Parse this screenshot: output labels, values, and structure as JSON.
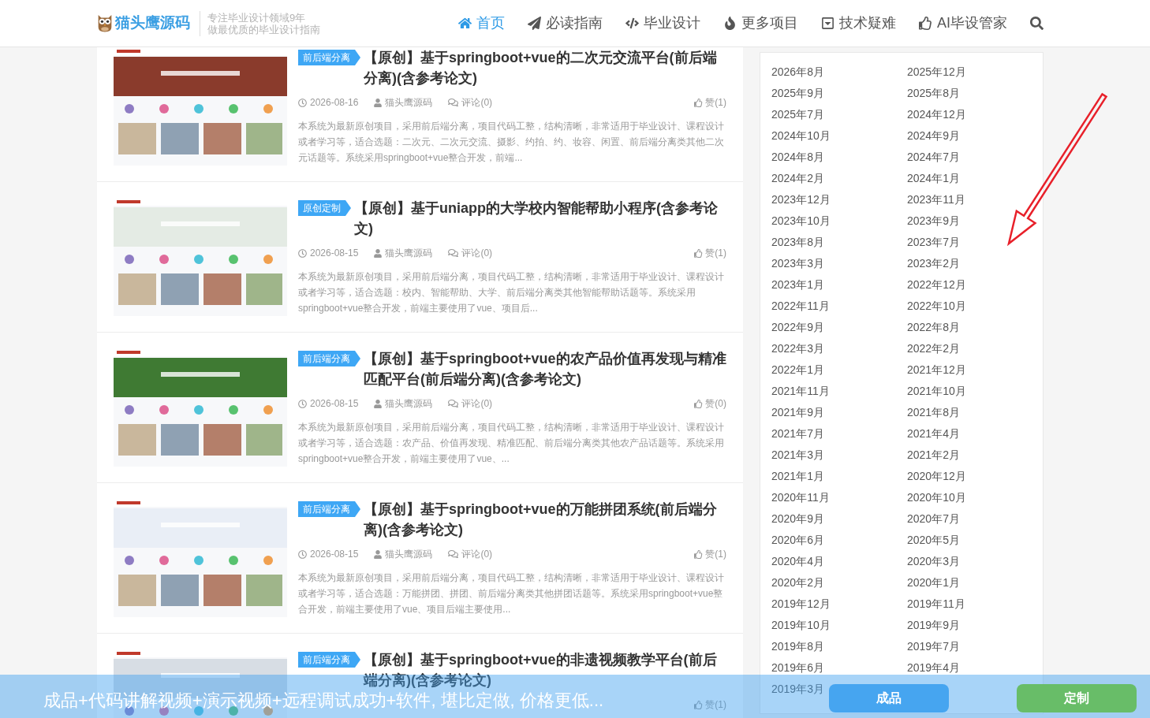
{
  "header": {
    "site_name": "猫头鹰源码",
    "tagline": [
      "专注毕业设计领域9年",
      "做最优质的毕业设计指南"
    ],
    "nav": [
      {
        "label": "首页",
        "selected": true
      },
      {
        "label": "必读指南",
        "selected": false
      },
      {
        "label": "毕业设计",
        "selected": false
      },
      {
        "label": "更多项目",
        "selected": false
      },
      {
        "label": "技术疑难",
        "selected": false
      },
      {
        "label": "AI毕设管家",
        "selected": false
      }
    ]
  },
  "articles": [
    {
      "tag": "前后端分离",
      "title": "【原创】基于springboot+vue的二次元交流平台(前后端分离)(含参考论文)",
      "date": "2026-08-16",
      "author": "猫头鹰源码",
      "comments": "评论(0)",
      "likes": "赞(1)",
      "excerpt": "本系统为最新原创项目，采用前后端分离，项目代码工整，结构清晰，非常适用于毕业设计、课程设计或者学习等，适合选题：二次元、二次元交流、摄影、约拍、约、妆容、闲置、前后端分离类其他二次元话题等。系统采用springboot+vue整合开发，前端..."
    },
    {
      "tag": "原创定制",
      "title": "【原创】基于uniapp的大学校内智能帮助小程序(含参考论文)",
      "date": "2026-08-15",
      "author": "猫头鹰源码",
      "comments": "评论(0)",
      "likes": "赞(1)",
      "excerpt": "本系统为最新原创项目，采用前后端分离，项目代码工整，结构清晰，非常适用于毕业设计、课程设计或者学习等，适合选题：校内、智能帮助、大学、前后端分离类其他智能帮助话题等。系统采用springboot+vue整合开发，前端主要使用了vue、项目后..."
    },
    {
      "tag": "前后端分离",
      "title": "【原创】基于springboot+vue的农产品价值再发现与精准匹配平台(前后端分离)(含参考论文)",
      "date": "2026-08-15",
      "author": "猫头鹰源码",
      "comments": "评论(0)",
      "likes": "赞(0)",
      "excerpt": "本系统为最新原创项目，采用前后端分离，项目代码工整，结构清晰，非常适用于毕业设计、课程设计或者学习等，适合选题：农产品、价值再发现、精准匹配、前后端分离类其他农产品话题等。系统采用springboot+vue整合开发，前端主要使用了vue、..."
    },
    {
      "tag": "前后端分离",
      "title": "【原创】基于springboot+vue的万能拼团系统(前后端分离)(含参考论文)",
      "date": "2026-08-15",
      "author": "猫头鹰源码",
      "comments": "评论(0)",
      "likes": "赞(1)",
      "excerpt": "本系统为最新原创项目，采用前后端分离，项目代码工整，结构清晰，非常适用于毕业设计、课程设计或者学习等，适合选题：万能拼团、拼团、前后端分离类其他拼团话题等。系统采用springboot+vue整合开发，前端主要使用了vue、项目后端主要使用..."
    },
    {
      "tag": "前后端分离",
      "title": "【原创】基于springboot+vue的非遗视频教学平台(前后端分离)(含参考论文)",
      "likes": "赞(1)"
    }
  ],
  "archive": {
    "months": [
      "2026年8月",
      "2025年12月",
      "2025年9月",
      "2025年8月",
      "2025年7月",
      "2024年12月",
      "2024年10月",
      "2024年9月",
      "2024年8月",
      "2024年7月",
      "2024年2月",
      "2024年1月",
      "2023年12月",
      "2023年11月",
      "2023年10月",
      "2023年9月",
      "2023年8月",
      "2023年7月",
      "2023年3月",
      "2023年2月",
      "2023年1月",
      "2022年12月",
      "2022年11月",
      "2022年10月",
      "2022年9月",
      "2022年8月",
      "2022年3月",
      "2022年2月",
      "2022年1月",
      "2021年12月",
      "2021年11月",
      "2021年10月",
      "2021年9月",
      "2021年8月",
      "2021年7月",
      "2021年4月",
      "2021年3月",
      "2021年2月",
      "2021年1月",
      "2020年12月",
      "2020年11月",
      "2020年10月",
      "2020年9月",
      "2020年7月",
      "2020年6月",
      "2020年5月",
      "2020年4月",
      "2020年3月",
      "2020年2月",
      "2020年1月",
      "2019年12月",
      "2019年11月",
      "2019年10月",
      "2019年9月",
      "2019年8月",
      "2019年7月",
      "2019年6月",
      "2019年4月",
      "2019年3月"
    ]
  },
  "promo_bar": {
    "text": "成品+代码讲解视频+演示视频+远程调试成功+软件, 堪比定做, 价格更低...",
    "buttons": [
      {
        "label": "成品",
        "kind": "product"
      },
      {
        "label": "定制",
        "kind": "custom"
      }
    ]
  }
}
